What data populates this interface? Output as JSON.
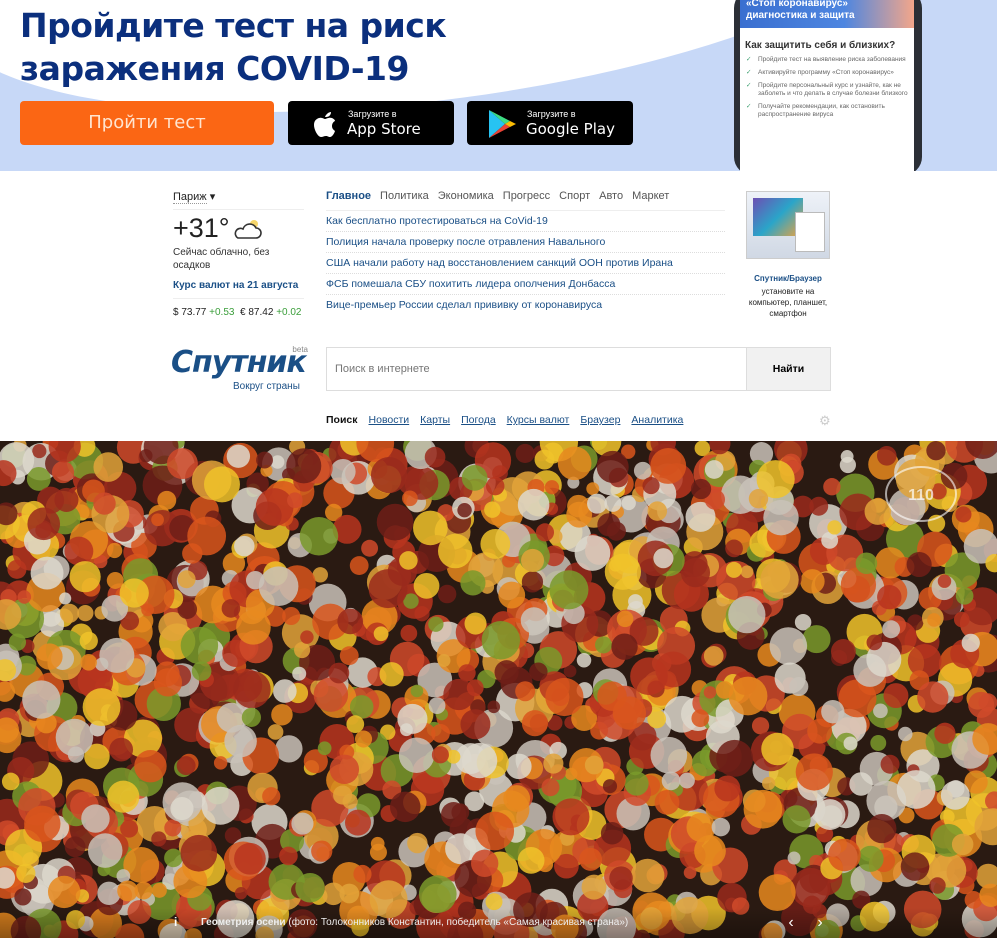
{
  "banner": {
    "title_line1": "Пройдите тест на риск",
    "title_line2": "заражения COVID-19",
    "test_button": "Пройти тест",
    "appstore": {
      "small": "Загрузите в",
      "big": "App Store"
    },
    "googleplay": {
      "small": "Загрузите в",
      "big": "Google Play"
    },
    "phone": {
      "header": "«Стоп коронавирус» диагностика и защита",
      "heading": "Как защитить себя и близких?",
      "items": [
        "Пройдите тест на выявление риска заболевания",
        "Активируйте программу «Стоп коронавирус»",
        "Пройдите персональный курс и узнайте, как не заболеть и что делать в случае болезни близкого",
        "Получайте рекомендации, как остановить распространение вируса"
      ]
    }
  },
  "weather": {
    "city": "Париж",
    "temp": "+31°",
    "desc": "Сейчас облачно, без осадков",
    "icon": "cloud-sun-icon"
  },
  "currency": {
    "title": "Курс валют на 21 августа",
    "usd": "$ 73.77",
    "usd_change": "+0.53",
    "eur": "€ 87.42",
    "eur_change": "+0.02"
  },
  "news": {
    "tabs": [
      "Главное",
      "Политика",
      "Экономика",
      "Прогресс",
      "Спорт",
      "Авто",
      "Маркет"
    ],
    "items": [
      "Как бесплатно протестироваться на CoVid-19",
      "Полиция начала проверку после отравления Навального",
      "США начали работу над восстановлением санкций ООН против Ирана",
      "ФСБ помешала СБУ похитить лидера ополчения Донбасса",
      "Вице-премьер России сделал прививку от коронавируса"
    ]
  },
  "promo": {
    "title": "Спутник/Браузер",
    "desc": "установите на компьютер, планшет, смартфон"
  },
  "logo": {
    "name": "Спутник",
    "beta": "beta",
    "sub": "Вокруг страны"
  },
  "search": {
    "placeholder": "Поиск в интернете",
    "button": "Найти",
    "nav": [
      "Поиск",
      "Новости",
      "Карты",
      "Погода",
      "Курсы валют",
      "Браузер",
      "Аналитика"
    ]
  },
  "photo": {
    "caption_title": "Геометрия осени",
    "caption_text": " (фото: Толоконников Константин, победитель «Самая красивая страна»)",
    "info": "i"
  },
  "colors": {
    "brand": "#1a4f86",
    "orange": "#fb6614",
    "banner_bg": "#c7d8f7"
  }
}
